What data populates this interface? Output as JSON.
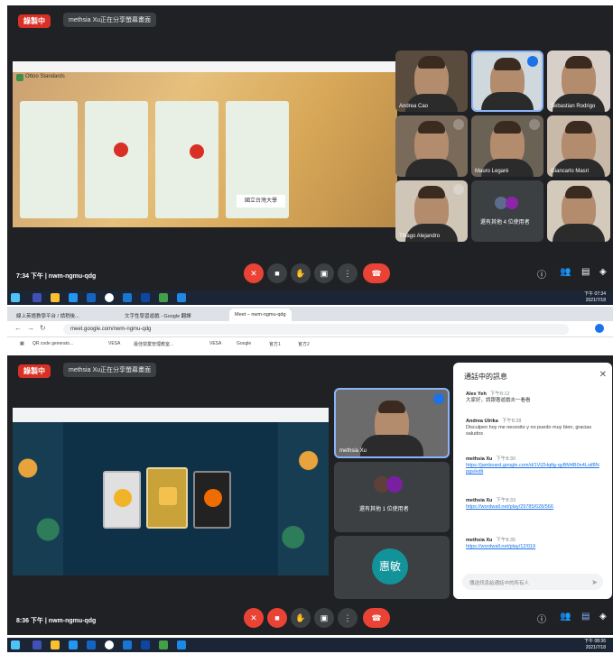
{
  "top": {
    "recording": "錄製中",
    "share_info": "methsia Xu正在分享螢幕畫面",
    "board_title": "Ottoo Standards",
    "participants": [
      "Andrea Cao",
      "",
      "Sebastian Rodrigo",
      "",
      "Mauro Legaré",
      "Giancarlo Masri",
      "Thiago Alejandro",
      "還有其他 4 位使用者",
      ""
    ],
    "time_code": "7:34 下午 | nwm-ngmu-qdg"
  },
  "browser": {
    "tabs": [
      "線上英語教學平台 / 請稍後...",
      "文字性學習遊戲 - Google 翻譯",
      "Meet – nwm-ngmu-qdg"
    ],
    "url": "meet.google.com/nwm-ngmu-qdg",
    "bookmarks": [
      "QR code generato...",
      "VESA",
      "最佳營業管理教室...",
      "VESA",
      "Google",
      "官方1",
      "官方2"
    ]
  },
  "bottom": {
    "recording": "錄製中",
    "share_info": "methsia Xu正在分享螢幕畫面",
    "self_name": "methsia Xu",
    "others": "還有其他 1 位使用者",
    "avatar": "惠敏",
    "time_code": "8:36 下午 | nwm-ngmu-qdg"
  },
  "chat": {
    "title": "通話中的訊息",
    "messages": [
      {
        "who": "Alex Yeh",
        "time": "下午8:12",
        "text": "大家好，請跟著遊戲去一看看"
      },
      {
        "who": "Andrea Ulrika",
        "time": "下午8:28",
        "text": "Disculpen hoy me necesito y no puedo muy bien, gracias saludos"
      },
      {
        "who": "methsia Xu",
        "time": "下午8:30",
        "link": "https://jamboard.google.com/d/1VIZHqfig-qyBM4B0n4Loif8Npgs/edit"
      },
      {
        "who": "methsia Xu",
        "time": "下午8:33",
        "link": "https://wordwall.net/play/29785/028/566"
      },
      {
        "who": "methsia Xu",
        "time": "下午8:35",
        "link": "https://wordwall.net/play/12/019"
      }
    ],
    "input_placeholder": "傳送訊息給通話中的所有人"
  },
  "taskbar": {
    "time1": "下午 07:34",
    "date1": "2021/7/18",
    "time2": "下午 08:36",
    "date2": "2021/7/18"
  },
  "colors": {
    "meet_bg": "#202124",
    "end_call": "#ea4335",
    "link": "#1a73e8"
  }
}
